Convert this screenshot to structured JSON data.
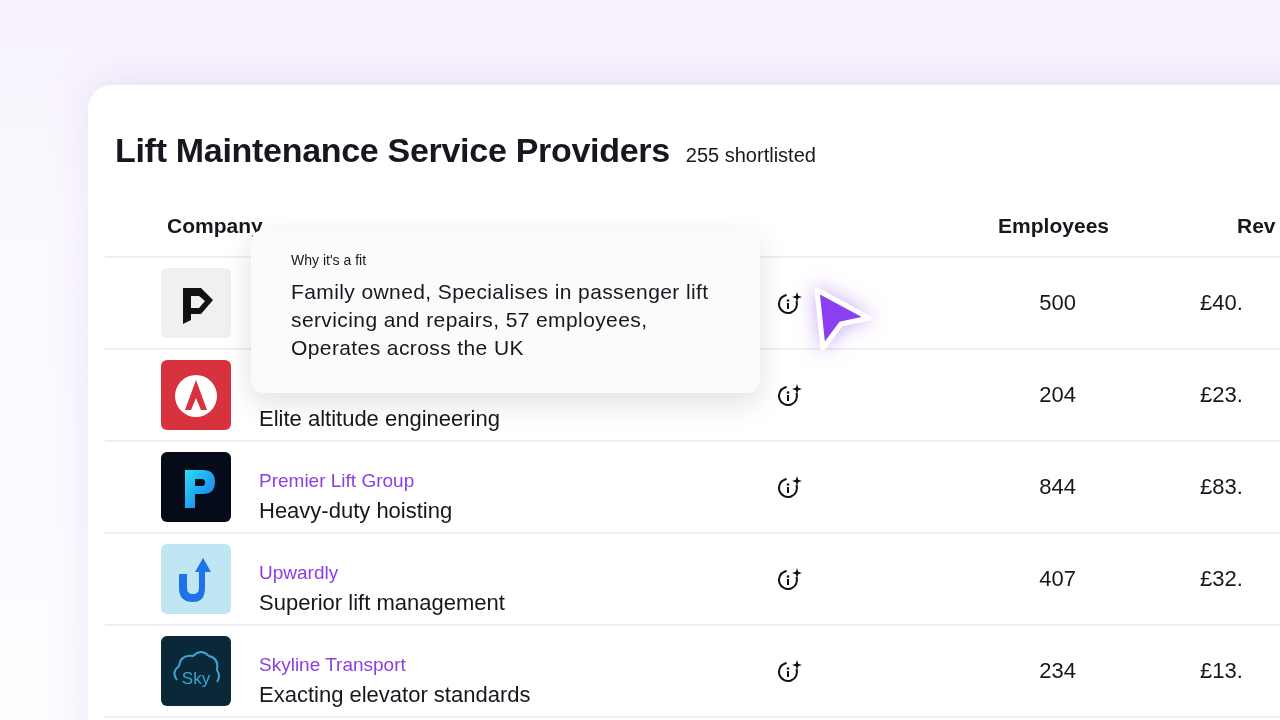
{
  "header": {
    "title": "Lift Maintenance Service Providers",
    "count": "255 shortlisted"
  },
  "table": {
    "columns": [
      "Company",
      "Employees",
      "Rev"
    ],
    "rows": [
      {
        "logo": {
          "kind": "p-mark"
        },
        "employees": "500",
        "revenue": "£40.",
        "fit_tooltip": {
          "title": "Why it's a fit",
          "text": "Family owned, Specialises in passenger lift servicing and repairs, 57 employees, Operates across the UK"
        }
      },
      {
        "logo": {
          "kind": "a-mark"
        },
        "tagline": "Elite altitude engineering",
        "employees": "204",
        "revenue": "£23."
      },
      {
        "logo": {
          "kind": "p-gradient"
        },
        "name": "Premier Lift Group",
        "tagline": "Heavy-duty hoisting",
        "employees": "844",
        "revenue": "£83."
      },
      {
        "logo": {
          "kind": "u-arrow"
        },
        "name": "Upwardly",
        "tagline": "Superior lift management",
        "employees": "407",
        "revenue": "£32."
      },
      {
        "logo": {
          "kind": "sky-cloud",
          "text": "Sky"
        },
        "name": "Skyline Transport",
        "tagline": "Exacting elevator standards",
        "employees": "234",
        "revenue": "£13."
      }
    ]
  }
}
